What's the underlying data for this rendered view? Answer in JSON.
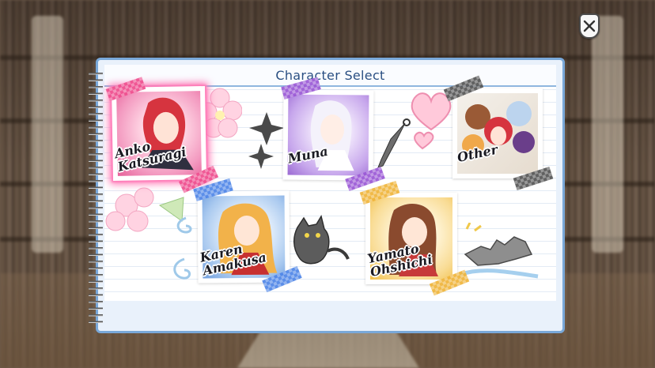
{
  "header": {
    "title": "Character Select"
  },
  "characters": [
    {
      "id": "anko",
      "name_line1": "Anko",
      "name_line2": "Katsuragi",
      "selected": true,
      "tape_color": "#ef4f8f"
    },
    {
      "id": "muna",
      "name_line1": "Muna",
      "name_line2": "",
      "selected": false,
      "tape_color": "#9b59d6"
    },
    {
      "id": "other",
      "name_line1": "Other",
      "name_line2": "",
      "selected": false,
      "tape_color": "#555555"
    },
    {
      "id": "karen",
      "name_line1": "Karen",
      "name_line2": "Amakusa",
      "selected": false,
      "tape_color": "#4f86e8"
    },
    {
      "id": "yamato",
      "name_line1": "Yamato",
      "name_line2": "Ohshichi",
      "selected": false,
      "tape_color": "#f0b53a"
    }
  ],
  "colors": {
    "panel_border": "#79a8d9",
    "title_text": "#2a4f82",
    "selection_glow": "#ff6fb0"
  },
  "icons": {
    "close": "crossed-swords-shield-icon"
  }
}
